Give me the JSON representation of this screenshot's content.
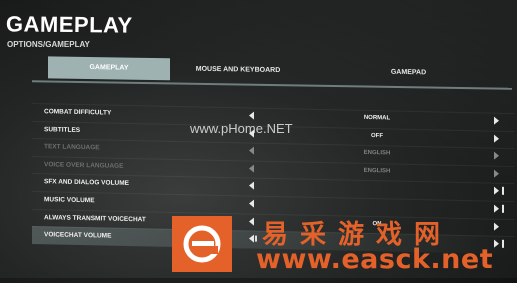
{
  "header": {
    "title": "GAMEPLAY",
    "breadcrumb": "OPTIONS/GAMEPLAY"
  },
  "tabs": [
    {
      "label": "GAMEPLAY",
      "active": true
    },
    {
      "label": "MOUSE AND KEYBOARD",
      "active": false
    },
    {
      "label": "GAMEPAD",
      "active": false
    }
  ],
  "settings": [
    {
      "label": "COMBAT DIFFICULTY",
      "value": "NORMAL",
      "enabled": true
    },
    {
      "label": "SUBTITLES",
      "value": "OFF",
      "enabled": true
    },
    {
      "label": "TEXT LANGUAGE",
      "value": "ENGLISH",
      "enabled": false
    },
    {
      "label": "VOICE OVER LANGUAGE",
      "value": "ENGLISH",
      "enabled": false
    },
    {
      "label": "SFX AND DIALOG VOLUME",
      "value": "",
      "enabled": true
    },
    {
      "label": "MUSIC VOLUME",
      "value": "",
      "enabled": true
    },
    {
      "label": "ALWAYS TRANSMIT VOICECHAT",
      "value": "ON",
      "enabled": true
    },
    {
      "label": "VOICECHAT VOLUME",
      "value": "",
      "enabled": true
    }
  ],
  "watermarks": {
    "overlay_url": "www.pHome.NET",
    "site_name_cn": "易采游戏网",
    "site_url": "www.easck.net"
  },
  "colors": {
    "active_tab": "#9fb2b2",
    "watermark_orange": "#e4622a"
  }
}
